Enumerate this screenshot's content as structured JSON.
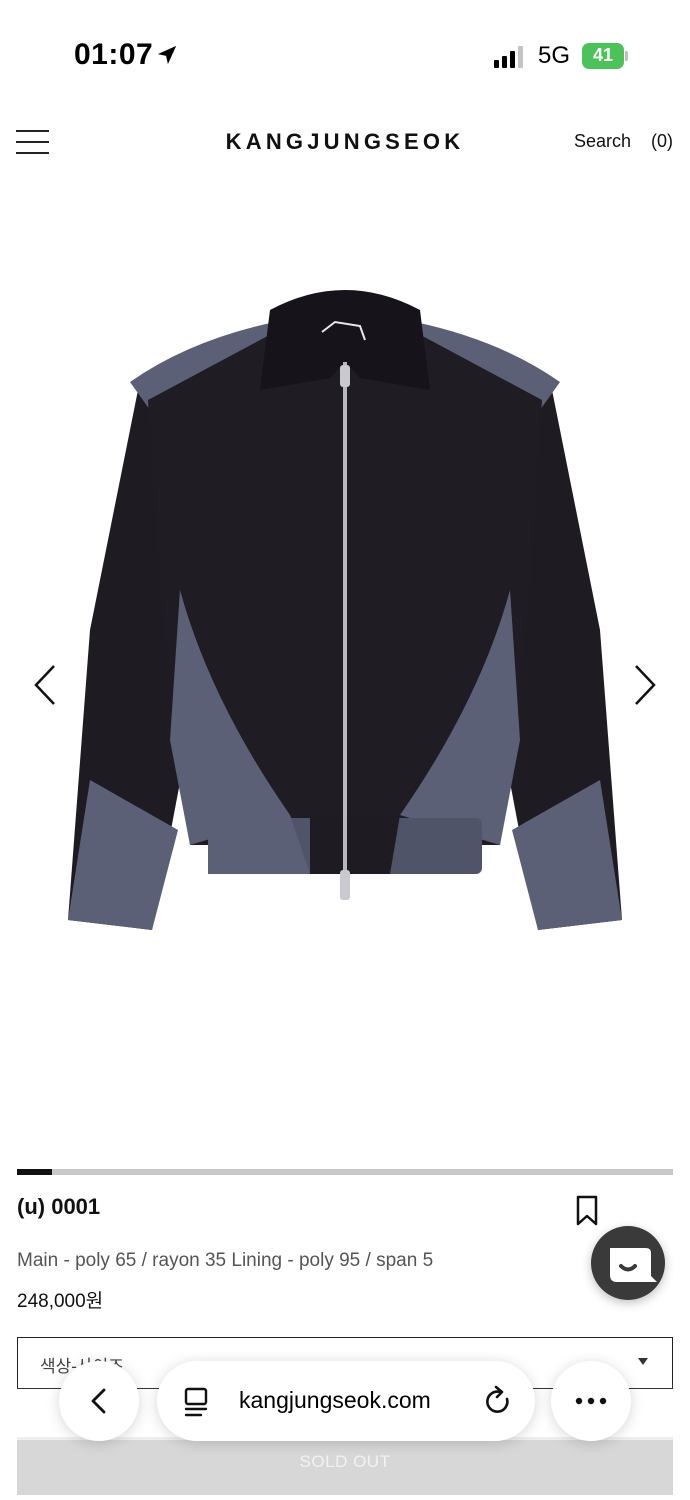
{
  "status_bar": {
    "time": "01:07",
    "network": "5G",
    "battery": "41"
  },
  "header": {
    "brand": "KANGJUNGSEOK",
    "search_label": "Search",
    "cart_count": "(0)"
  },
  "gallery": {
    "progress_fraction": 0.053
  },
  "product": {
    "name": "(u) 0001",
    "material": "Main - poly 65 / rayon 35 Lining - poly 95 / span 5",
    "price": "248,000원"
  },
  "option_select": {
    "placeholder": "색상-사이즈"
  },
  "sold_out_label": "SOLD OUT",
  "browser": {
    "url": "kangjungseok.com"
  },
  "colors": {
    "jacket_body": "#1f1b22",
    "jacket_panel": "#5b6077",
    "battery": "#4cc35a"
  }
}
